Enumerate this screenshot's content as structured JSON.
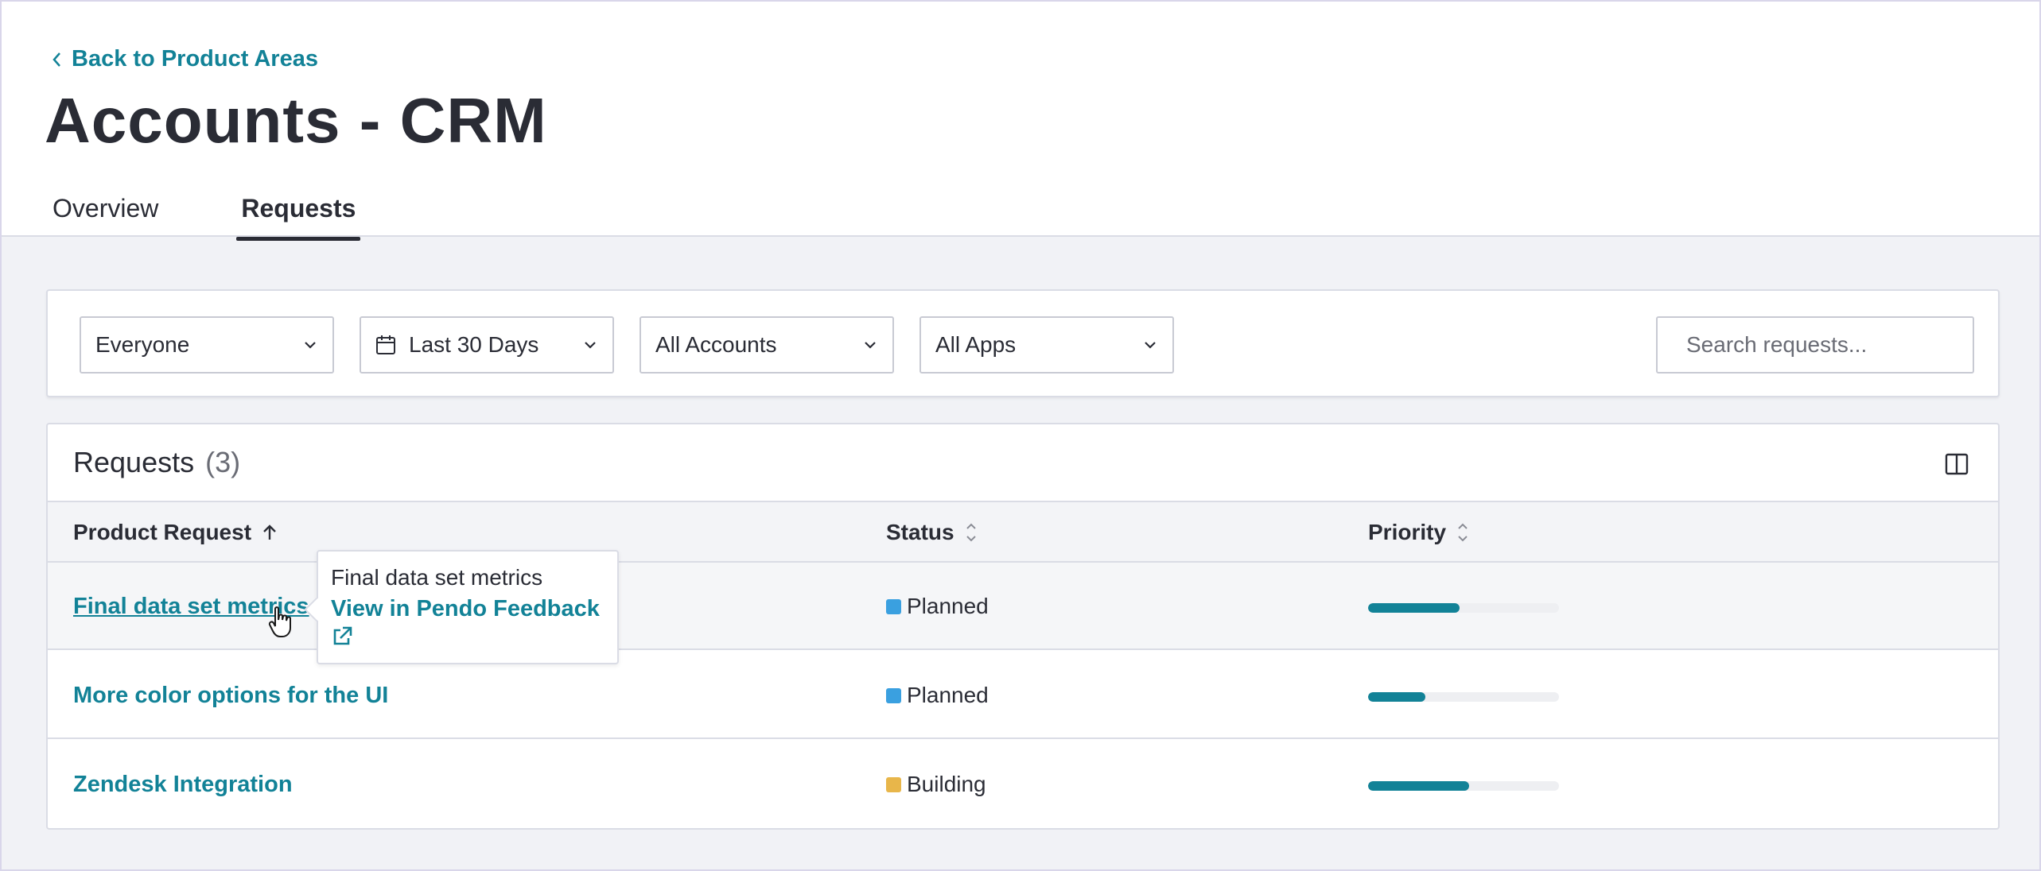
{
  "header": {
    "back_label": "Back to Product Areas",
    "title": "Accounts - CRM",
    "tabs": [
      {
        "label": "Overview",
        "active": false
      },
      {
        "label": "Requests",
        "active": true
      }
    ]
  },
  "filters": {
    "segment": "Everyone",
    "date_range": "Last 30 Days",
    "accounts": "All Accounts",
    "apps": "All Apps",
    "search_placeholder": "Search requests..."
  },
  "table": {
    "title": "Requests",
    "count": "(3)",
    "columns": {
      "product_request": "Product Request",
      "status": "Status",
      "priority": "Priority"
    },
    "rows": [
      {
        "name": "Final data set metrics",
        "status": "Planned",
        "status_color": "#3aa0e0",
        "priority": 0.48
      },
      {
        "name": "More color options for the UI",
        "status": "Planned",
        "status_color": "#3aa0e0",
        "priority": 0.3
      },
      {
        "name": "Zendesk Integration",
        "status": "Building",
        "status_color": "#e8b64a",
        "priority": 0.53
      }
    ]
  },
  "tooltip": {
    "title": "Final data set metrics",
    "link_label": "View in Pendo Feedback"
  },
  "colors": {
    "accent": "#128297",
    "text": "#2a2c35"
  }
}
